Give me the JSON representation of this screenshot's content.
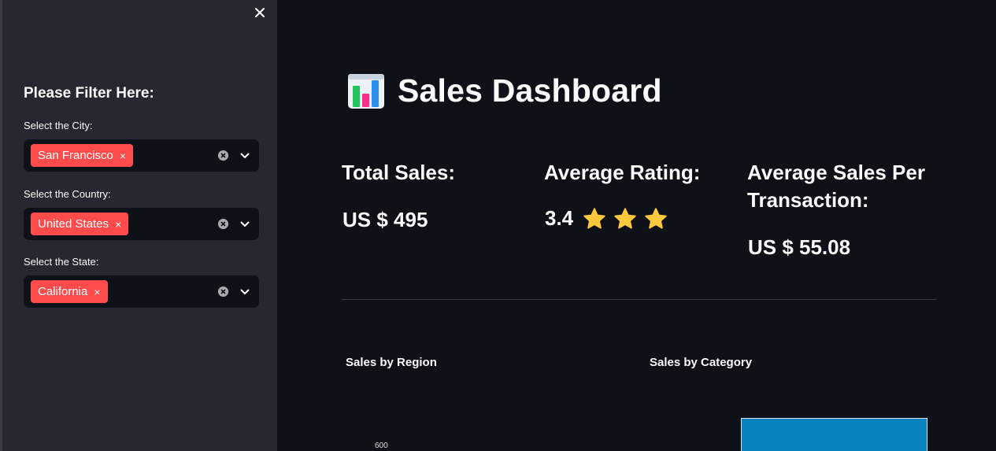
{
  "sidebar": {
    "close_icon": "close-icon",
    "filter_title": "Please Filter Here:",
    "filters": [
      {
        "label": "Select the City:",
        "selected": "San Francisco"
      },
      {
        "label": "Select the Country:",
        "selected": "United States"
      },
      {
        "label": "Select the State:",
        "selected": "California"
      }
    ],
    "chip_remove_glyph": "×",
    "accent_color": "#ff4b4b"
  },
  "main": {
    "title_icon": "bar-chart-icon",
    "title": "Sales Dashboard",
    "metrics": {
      "total_sales": {
        "label": "Total Sales:",
        "value": "US $ 495"
      },
      "average_rating": {
        "label": "Average Rating:",
        "value": "3.4",
        "stars": 3,
        "star_color": "#ffc83d"
      },
      "average_sales_per_transaction": {
        "label": "Average Sales Per Transaction:",
        "value": "US $ 55.08"
      }
    },
    "charts": {
      "region_title": "Sales by Region",
      "category_title": "Sales by Category",
      "region_y_tick": "600",
      "bar_color": "#0883c0"
    }
  }
}
